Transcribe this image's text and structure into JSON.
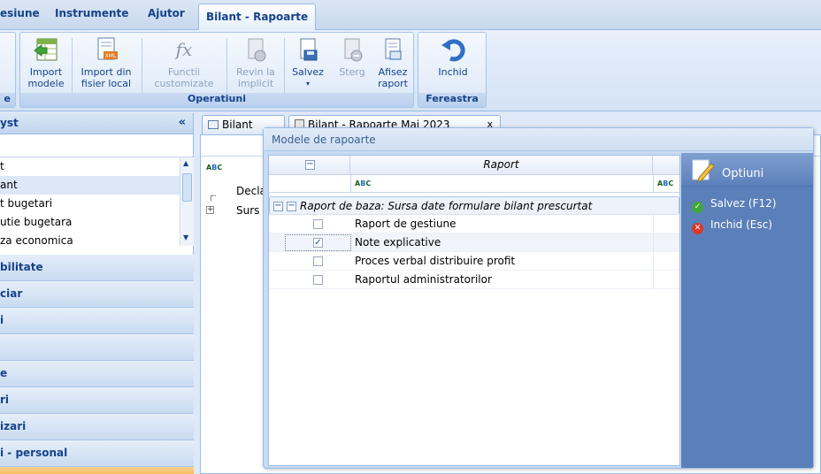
{
  "menu": {
    "tabs": [
      {
        "label": "esiune"
      },
      {
        "label": "Instrumente"
      },
      {
        "label": "Ajutor"
      },
      {
        "label": "Bilant - Rapoarte"
      }
    ]
  },
  "ribbon": {
    "first_group_title_fragment": "e",
    "operatiuni": {
      "title": "Operatiuni",
      "buttons": [
        {
          "label": "Import modele"
        },
        {
          "label": "Import din fisier local"
        },
        {
          "label": "Functii customizate"
        },
        {
          "label": "Revin la implicit"
        },
        {
          "label": "Salvez"
        },
        {
          "label": "Sterg"
        },
        {
          "label": "Afisez raport"
        }
      ]
    },
    "fereastra": {
      "title": "Fereastra",
      "buttons": [
        {
          "label": "Inchid"
        }
      ]
    }
  },
  "left_panel": {
    "title": "yst",
    "collapse_glyph": "«",
    "list": [
      {
        "label": "t"
      },
      {
        "label": "ant"
      },
      {
        "label": "t bugetari"
      },
      {
        "label": "utie bugetara"
      },
      {
        "label": "za economica"
      }
    ],
    "accordion": [
      {
        "label": "bilitate"
      },
      {
        "label": "ciar"
      },
      {
        "label": "i"
      },
      {
        "label": ""
      },
      {
        "label": "e"
      },
      {
        "label": "ri"
      },
      {
        "label": "izari"
      },
      {
        "label": "i - personal"
      }
    ]
  },
  "documents": {
    "tabs": [
      {
        "label": "Bilant"
      },
      {
        "label": "Bilant - Rapoarte Mai 2023"
      }
    ],
    "close_glyph": "x",
    "tree": [
      {
        "label": "Decla"
      },
      {
        "label": "Surs"
      }
    ]
  },
  "dialog": {
    "title": "Modele de rapoarte",
    "grid": {
      "column_header": "Raport",
      "group_label": "Raport de baza: Sursa date formulare bilant prescurtat",
      "rows": [
        {
          "label": "Raport de gestiune",
          "checked": false
        },
        {
          "label": "Note explicative",
          "checked": true
        },
        {
          "label": "Proces verbal distribuire profit",
          "checked": false
        },
        {
          "label": "Raportul administratorilor",
          "checked": false
        }
      ]
    },
    "side": {
      "header": "Optiuni",
      "actions": [
        {
          "label": "Salvez (F12)",
          "color": "#3fa63a"
        },
        {
          "label": "Inchid (Esc)",
          "color": "#d8392b"
        }
      ]
    }
  },
  "colors": {
    "accent": "#15428b",
    "panel_blue": "#5b7fb8",
    "border": "#99bbe8"
  }
}
